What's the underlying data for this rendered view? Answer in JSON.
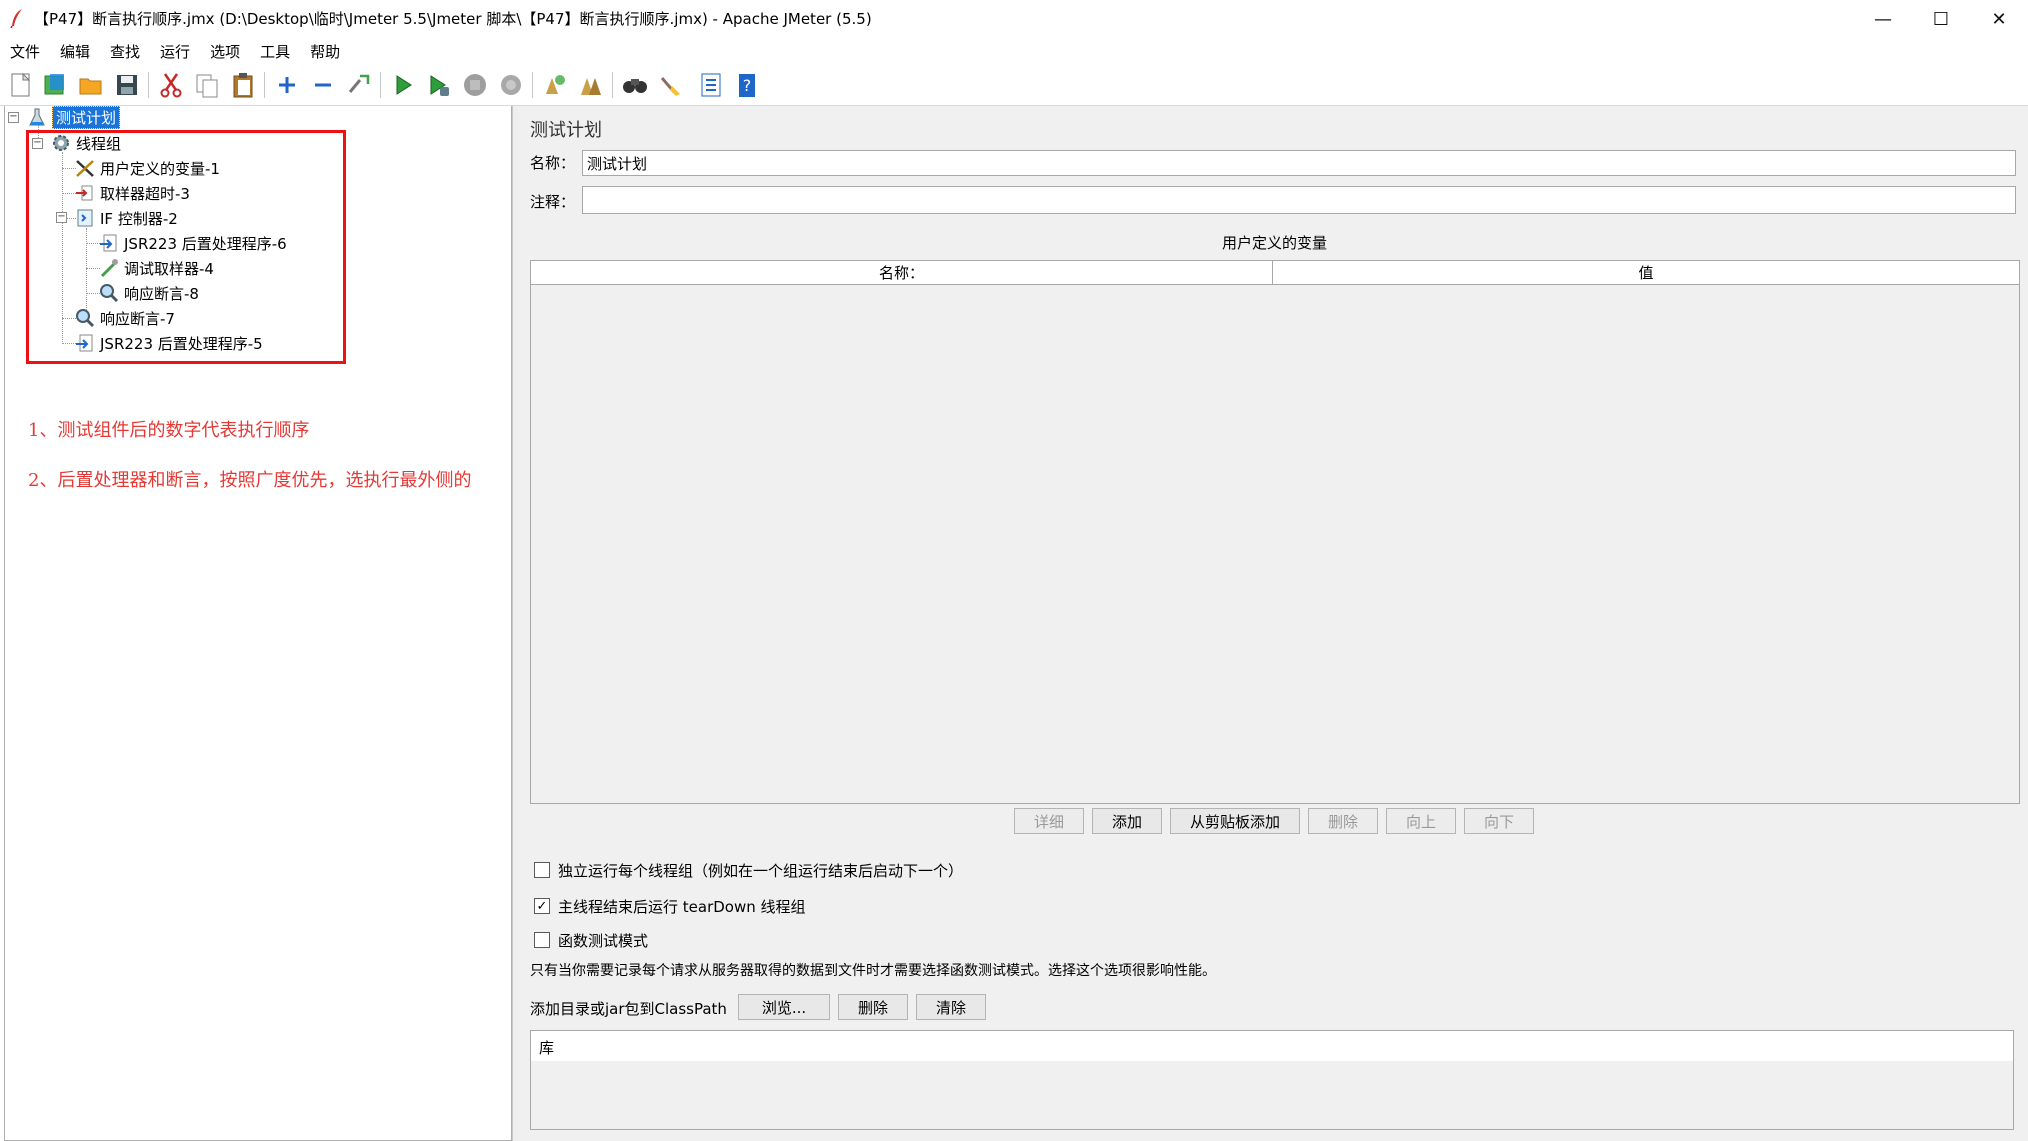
{
  "window": {
    "title": "【P47】断言执行顺序.jmx (D:\\Desktop\\临时\\Jmeter 5.5\\Jmeter 脚本\\【P47】断言执行顺序.jmx) - Apache JMeter (5.5)",
    "minimize": "—",
    "maximize": "☐",
    "close": "✕"
  },
  "menu": [
    "文件",
    "编辑",
    "查找",
    "运行",
    "选项",
    "工具",
    "帮助"
  ],
  "toolbar": {
    "icons": [
      "new-icon",
      "templates-icon",
      "open-icon",
      "save-icon",
      "cut-icon",
      "copy-icon",
      "paste-icon",
      "expand-all-icon",
      "collapse-all-icon",
      "toggle-icon",
      "start-icon",
      "start-no-pause-icon",
      "stop-icon",
      "shutdown-icon",
      "clear-icon",
      "clear-all-icon",
      "search-icon",
      "reset-search-icon",
      "function-helper-icon",
      "help-icon"
    ]
  },
  "tree": {
    "root": "测试计划",
    "thread_group": "线程组",
    "items": [
      {
        "label": "用户定义的变量-1",
        "icon": "tools-icon"
      },
      {
        "label": "取样器超时-3",
        "icon": "timeout-icon"
      },
      {
        "label": "IF 控制器-2",
        "icon": "if-controller-icon"
      },
      {
        "label": "JSR223 后置处理程序-6",
        "icon": "postprocessor-icon"
      },
      {
        "label": "调试取样器-4",
        "icon": "pipette-icon"
      },
      {
        "label": "响应断言-8",
        "icon": "magnifier-icon"
      },
      {
        "label": "响应断言-7",
        "icon": "magnifier-icon"
      },
      {
        "label": "JSR223 后置处理程序-5",
        "icon": "postprocessor-icon"
      }
    ]
  },
  "annotations": [
    "1、测试组件后的数字代表执行顺序",
    "2、后置处理器和断言，按照广度优先，选执行最外侧的"
  ],
  "panel": {
    "heading": "测试计划",
    "name_label": "名称：",
    "name_value": "测试计划",
    "comment_label": "注释：",
    "comment_value": "",
    "vars_title": "用户定义的变量",
    "col_name": "名称：",
    "col_value": "值",
    "buttons": {
      "detail": "详细",
      "add": "添加",
      "add_clipboard": "从剪贴板添加",
      "delete": "删除",
      "up": "向上",
      "down": "向下"
    },
    "checkbox_1": "独立运行每个线程组（例如在一个组运行结束后启动下一个）",
    "checkbox_1_checked": false,
    "checkbox_2": "主线程结束后运行 tearDown 线程组",
    "checkbox_2_checked": true,
    "checkbox_3": "函数测试模式",
    "checkbox_3_checked": false,
    "functional_note": "只有当你需要记录每个请求从服务器取得的数据到文件时才需要选择函数测试模式。选择这个选项很影响性能。",
    "classpath_label": "添加目录或jar包到ClassPath",
    "browse": "浏览...",
    "cp_delete": "删除",
    "cp_clear": "清除",
    "lib_header": "库"
  },
  "colors": {
    "selection": "#1a73d9",
    "annotation_red": "#e53935",
    "panel_bg": "#f0f0f0"
  }
}
